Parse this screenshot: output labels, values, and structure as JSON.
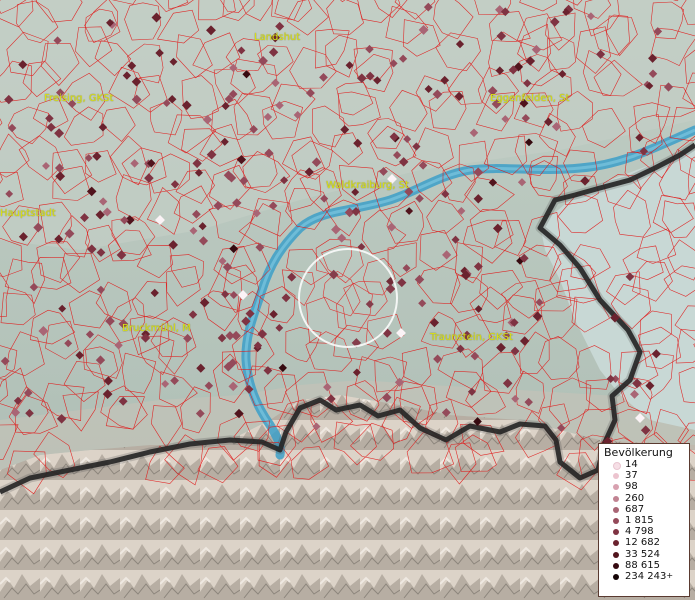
{
  "map": {
    "city_labels": [
      {
        "id": "landshut",
        "text": "Landshut"
      },
      {
        "id": "freising",
        "text": "Freising, GKSt"
      },
      {
        "id": "eggenfelden",
        "text": "Eggenfelden, St"
      },
      {
        "id": "waldkraiburg",
        "text": "Waldkraiburg, St"
      },
      {
        "id": "hauptstadt",
        "text": "Hauptstadt"
      },
      {
        "id": "bruckmuehl",
        "text": "Bruckmühl, M"
      },
      {
        "id": "traunstein",
        "text": "Traunstein, GKSt"
      }
    ],
    "colors": {
      "borders": "#e01818",
      "river": "#3c9fc8",
      "country_border": "#141414",
      "label": "#d9e11a",
      "plain": "#b9c6bd",
      "alps": "#ddd5cc",
      "lake": "#c8d8d5"
    }
  },
  "legend": {
    "title": "Bevölkerung",
    "items": [
      {
        "label": "14",
        "color": "#f6dfe6"
      },
      {
        "label": "37",
        "color": "#ecc4cf"
      },
      {
        "label": "98",
        "color": "#d8a1b0"
      },
      {
        "label": "260",
        "color": "#c18392"
      },
      {
        "label": "687",
        "color": "#a96575"
      },
      {
        "label": "1 815",
        "color": "#944a5a"
      },
      {
        "label": "4 798",
        "color": "#7f3342"
      },
      {
        "label": "12 682",
        "color": "#6a222e"
      },
      {
        "label": "33 524",
        "color": "#51141d"
      },
      {
        "label": "88 615",
        "color": "#360a10"
      },
      {
        "label": "234 243",
        "color": "#140406",
        "plus": "+"
      }
    ]
  }
}
